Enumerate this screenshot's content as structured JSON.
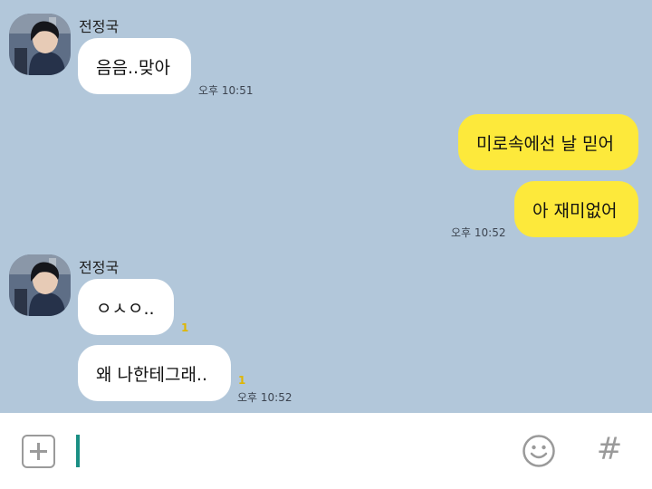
{
  "messages": {
    "group1": {
      "sender": "전정국",
      "text1": "음음..맞아",
      "time1": "오후 10:51"
    },
    "group2": {
      "text1": "미로속에선 날 믿어",
      "text2": "아 재미없어",
      "time2": "오후 10:52"
    },
    "group3": {
      "sender": "전정국",
      "text1": "ㅇㅅㅇ..",
      "unread1": "1",
      "text2": "왜 나한테그래..",
      "unread2": "1",
      "time2": "오후 10:52"
    }
  },
  "composer": {
    "input_value": "",
    "plus_icon": "plus-square-icon",
    "emoji_icon": "smiley-icon",
    "hash_icon": "hash-icon",
    "hash_glyph": "#"
  },
  "colors": {
    "chat_background": "#b2c7da",
    "outgoing_bubble": "#fde93b",
    "incoming_bubble": "#ffffff",
    "unread_count": "#e0b600",
    "caret": "#1a8f84"
  }
}
